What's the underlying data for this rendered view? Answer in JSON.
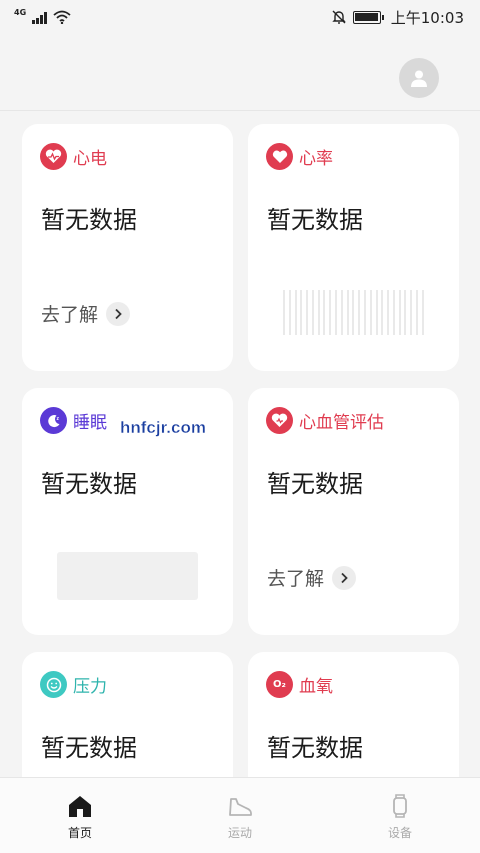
{
  "status_bar": {
    "network": "4G",
    "time": "上午10:03"
  },
  "colors": {
    "ecg": "#e03c50",
    "heart_rate": "#e03c50",
    "sleep": "#5b3ad6",
    "cardio": "#e03c50",
    "stress": "#3ec9c2",
    "oxygen": "#e03c50"
  },
  "cards": {
    "ecg": {
      "title": "心电",
      "value": "暂无数据",
      "link": "去了解",
      "icon": "heart-ecg-icon"
    },
    "heart_rate": {
      "title": "心率",
      "value": "暂无数据",
      "icon": "heart-icon"
    },
    "sleep": {
      "title": "睡眠",
      "value": "暂无数据",
      "icon": "moon-icon"
    },
    "cardio": {
      "title": "心血管评估",
      "value": "暂无数据",
      "link": "去了解",
      "icon": "heart-pulse-icon"
    },
    "stress": {
      "title": "压力",
      "value": "暂无数据",
      "icon": "smile-icon"
    },
    "oxygen": {
      "title": "血氧",
      "value": "暂无数据",
      "icon_text": "O₂"
    }
  },
  "watermark": "hnfcjr.com",
  "tabs": [
    {
      "label": "首页",
      "icon": "home-icon",
      "active": true
    },
    {
      "label": "运动",
      "icon": "shoe-icon",
      "active": false
    },
    {
      "label": "设备",
      "icon": "watch-icon",
      "active": false
    }
  ]
}
